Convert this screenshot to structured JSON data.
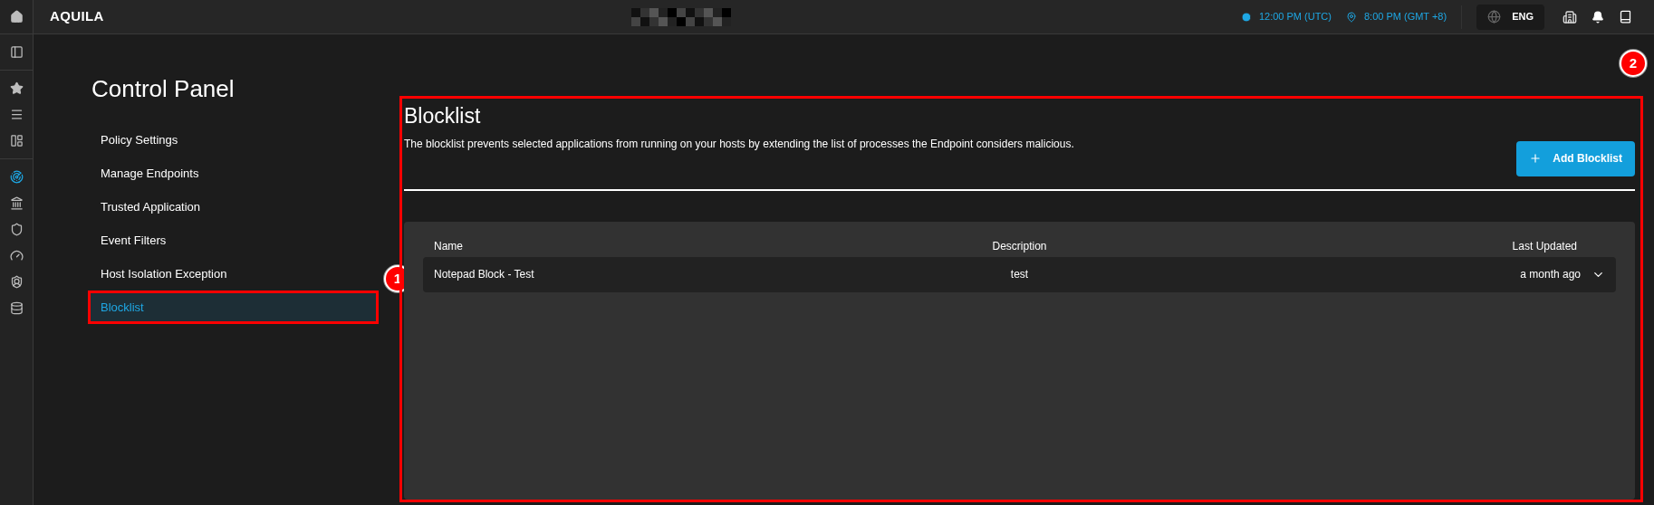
{
  "top_bar": {
    "logo": "AQUILA",
    "utc_time": "12:00 PM (UTC)",
    "local_time": "8:00 PM (GMT +8)",
    "language": "ENG"
  },
  "rail": [
    {
      "kind": "home",
      "selected": false
    },
    {
      "kind": "panel",
      "selected": false
    },
    {
      "kind": "star",
      "selected": false
    },
    {
      "kind": "list",
      "selected": false
    },
    {
      "kind": "layout",
      "selected": false
    },
    {
      "kind": "radar",
      "selected": true
    },
    {
      "kind": "bank",
      "selected": false
    },
    {
      "kind": "shield",
      "selected": false
    },
    {
      "kind": "gauge",
      "selected": false
    },
    {
      "kind": "badge",
      "selected": false
    },
    {
      "kind": "database",
      "selected": false
    }
  ],
  "sidebar": {
    "title": "Control Panel",
    "items": [
      {
        "label": "Policy Settings",
        "selected": false
      },
      {
        "label": "Manage Endpoints",
        "selected": false
      },
      {
        "label": "Trusted Application",
        "selected": false
      },
      {
        "label": "Event Filters",
        "selected": false
      },
      {
        "label": "Host Isolation Exception",
        "selected": false
      },
      {
        "label": "Blocklist",
        "selected": true
      }
    ]
  },
  "annotations": [
    {
      "label": "1"
    },
    {
      "label": "2"
    }
  ],
  "content": {
    "title": "Blocklist",
    "description": "The blocklist prevents selected applications from running on your hosts by extending the list of processes the Endpoint considers malicious.",
    "add_button": "Add Blocklist",
    "table": {
      "columns": [
        "Name",
        "Description",
        "Last Updated"
      ],
      "rows": [
        {
          "name": "Notepad Block - Test",
          "description": "test",
          "last_updated": "a month ago",
          "expanded": false
        }
      ]
    }
  }
}
